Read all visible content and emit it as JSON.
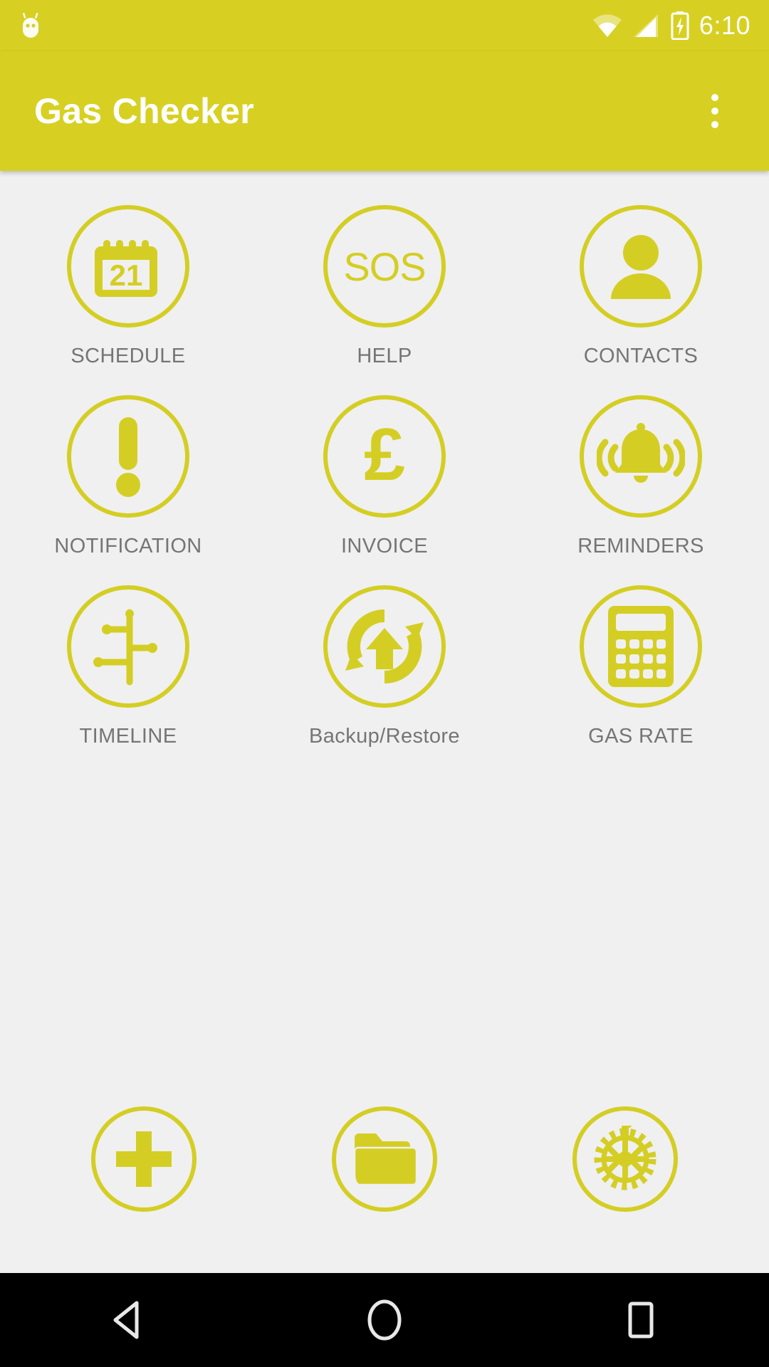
{
  "status_bar": {
    "os_icon": "android-robot-icon",
    "icons": [
      "wifi-icon",
      "cellular-signal-icon",
      "battery-charging-icon"
    ],
    "clock": "6:10"
  },
  "app_bar": {
    "title": "Gas Checker",
    "overflow_menu": "overflow-menu-icon"
  },
  "colors": {
    "brand_yellow": "#D7D022",
    "icon_yellow": "#D4CE24",
    "label_gray": "#757575",
    "background": "#F0F0F0",
    "navbar": "#000000",
    "title_white": "#FFFFFF"
  },
  "grid": {
    "columns": 3,
    "tiles": [
      {
        "label": "SCHEDULE",
        "icon": "calendar-21-icon",
        "badge": "21"
      },
      {
        "label": "HELP",
        "icon": "sos-icon",
        "badge": "SOS"
      },
      {
        "label": "CONTACTS",
        "icon": "person-icon",
        "badge": ""
      },
      {
        "label": "NOTIFICATION",
        "icon": "exclamation-icon",
        "badge": ""
      },
      {
        "label": "INVOICE",
        "icon": "pound-sterling-icon",
        "badge": "£"
      },
      {
        "label": "REMINDERS",
        "icon": "ringing-bell-icon",
        "badge": ""
      },
      {
        "label": "TIMELINE",
        "icon": "timeline-branch-icon",
        "badge": ""
      },
      {
        "label": "Backup/Restore",
        "icon": "backup-restore-icon",
        "badge": ""
      },
      {
        "label": "GAS RATE",
        "icon": "calculator-icon",
        "badge": ""
      }
    ]
  },
  "action_row": {
    "buttons": [
      {
        "name": "add-button",
        "icon": "plus-icon"
      },
      {
        "name": "folder-button",
        "icon": "folder-icon"
      },
      {
        "name": "settings-button",
        "icon": "gear-icon"
      }
    ]
  },
  "nav_bar": {
    "buttons": [
      {
        "name": "back-button",
        "icon": "back-triangle-icon"
      },
      {
        "name": "home-button",
        "icon": "home-circle-icon"
      },
      {
        "name": "recents-button",
        "icon": "recents-square-icon"
      }
    ]
  }
}
